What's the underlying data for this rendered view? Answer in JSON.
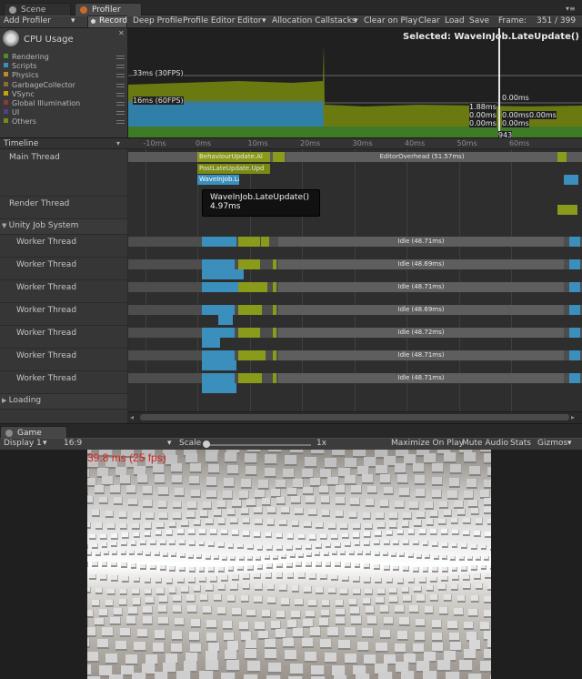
{
  "tabs": {
    "scene": "Scene",
    "profiler": "Profiler"
  },
  "toolbar": {
    "add_profiler": "Add Profiler",
    "record": "Record",
    "deep_profile": "Deep Profile",
    "profile_editor": "Profile Editor",
    "editor": "Editor",
    "allocation_callstacks": "Allocation Callstacks",
    "clear_on_play": "Clear on Play",
    "clear": "Clear",
    "load": "Load",
    "save": "Save",
    "frame_label": "Frame:",
    "frame_value": "351 / 399"
  },
  "cpu": {
    "title": "CPU Usage",
    "legend": [
      {
        "label": "Rendering",
        "color": "#4e8a2e"
      },
      {
        "label": "Scripts",
        "color": "#3a8fbd"
      },
      {
        "label": "Physics",
        "color": "#c08a20"
      },
      {
        "label": "GarbageCollector",
        "color": "#8a6a3a"
      },
      {
        "label": "VSync",
        "color": "#c6a400"
      },
      {
        "label": "Global Illumination",
        "color": "#8a3a3a"
      },
      {
        "label": "UI",
        "color": "#5a3a8a"
      },
      {
        "label": "Others",
        "color": "#7a8a1a"
      }
    ],
    "selected": "Selected: WaveInJob.LateUpdate()",
    "line_30fps": "33ms (30FPS)",
    "line_60fps": "16ms (60FPS)",
    "values": [
      "0.00ms",
      "1.88ms",
      "0.00ms",
      "0.00ms",
      "0.00ms",
      "0.00ms",
      "0.00ms"
    ],
    "frame_marker": "943"
  },
  "timeline": {
    "header": "Timeline",
    "ticks": [
      "-10ms",
      "0ms",
      "10ms",
      "20ms",
      "30ms",
      "40ms",
      "50ms",
      "60ms"
    ],
    "main_thread": "Main Thread",
    "render_thread": "Render Thread",
    "job_system": "Unity Job System",
    "worker": "Worker Thread",
    "loading": "Loading",
    "main_blocks": [
      "BehaviourUpdate.Al",
      "PostLateUpdate.Upd",
      "WaveInJob.LateUpda"
    ],
    "editor_overhead": "EditorOverhead (51.57ms)",
    "worker_idle": [
      "Idle (48.71ms)",
      "Idle (48.69ms)",
      "Idle (48.71ms)",
      "Idle (48.69ms)",
      "Idle (48.72ms)",
      "Idle (48.71ms)",
      "Idle (48.71ms)"
    ],
    "tooltip_title": "WaveInJob.LateUpdate()",
    "tooltip_value": "4.97ms"
  },
  "game": {
    "tab": "Game",
    "display": "Display 1",
    "aspect": "16:9",
    "scale_label": "Scale",
    "scale_value": "1x",
    "maximize": "Maximize On Play",
    "mute": "Mute Audio",
    "stats": "Stats",
    "gizmos": "Gizmos",
    "fps": "39.8 ms (25 fps)"
  }
}
